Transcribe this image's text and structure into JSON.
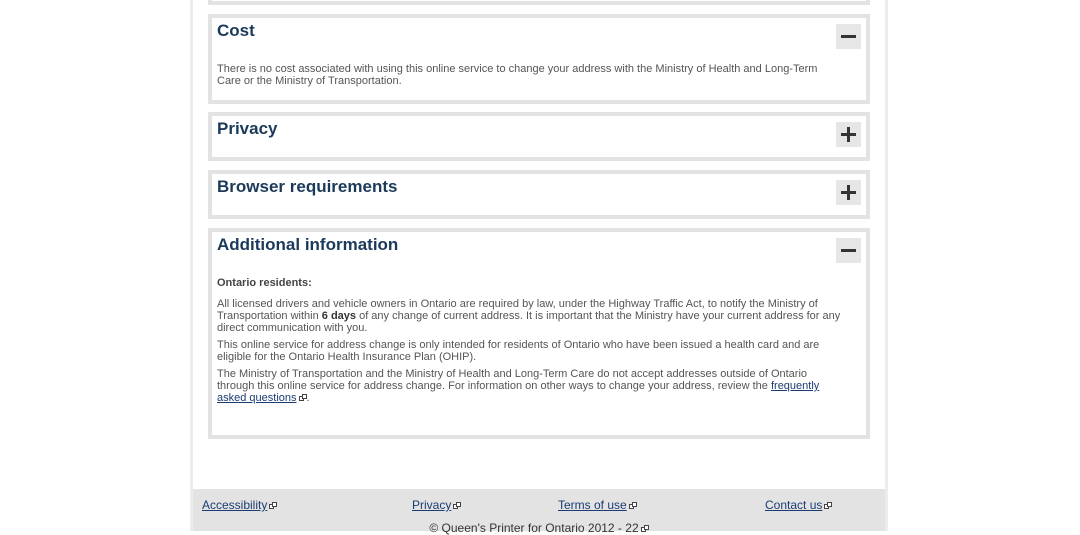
{
  "sections": {
    "cost": {
      "title": "Cost",
      "toggle": "collapse",
      "text": "There is no cost associated with using this online service to change your address with the Ministry of Health and Long-Term Care or the Ministry of Transportation."
    },
    "privacy": {
      "title": "Privacy",
      "toggle": "expand"
    },
    "browser": {
      "title": "Browser requirements",
      "toggle": "expand"
    },
    "additional": {
      "title": "Additional information",
      "toggle": "collapse",
      "subhead": "Ontario residents:",
      "p1_a": "All licensed drivers and vehicle owners in Ontario are required by law, under the Highway Traffic Act, to notify the Ministry of Transportation within ",
      "p1_bold": "6 days",
      "p1_b": " of any change of current address. It is important that the Ministry have your current address for any direct communication with you.",
      "p2": "This online service for address change is only intended for residents of Ontario who have been issued a health card and are eligible for the Ontario Health Insurance Plan (OHIP).",
      "p3_a": "The Ministry of Transportation and the Ministry of Health and Long-Term Care do not accept addresses outside of Ontario through this online service for address change. For information on other ways to change your address, review the ",
      "p3_link": "frequently asked questions",
      "p3_b": "."
    }
  },
  "footer": {
    "accessibility": "Accessibility",
    "privacy": "Privacy",
    "terms": "Terms of use",
    "contact": "Contact us",
    "copyright": "© Queen's Printer for Ontario 2012 - 22"
  }
}
